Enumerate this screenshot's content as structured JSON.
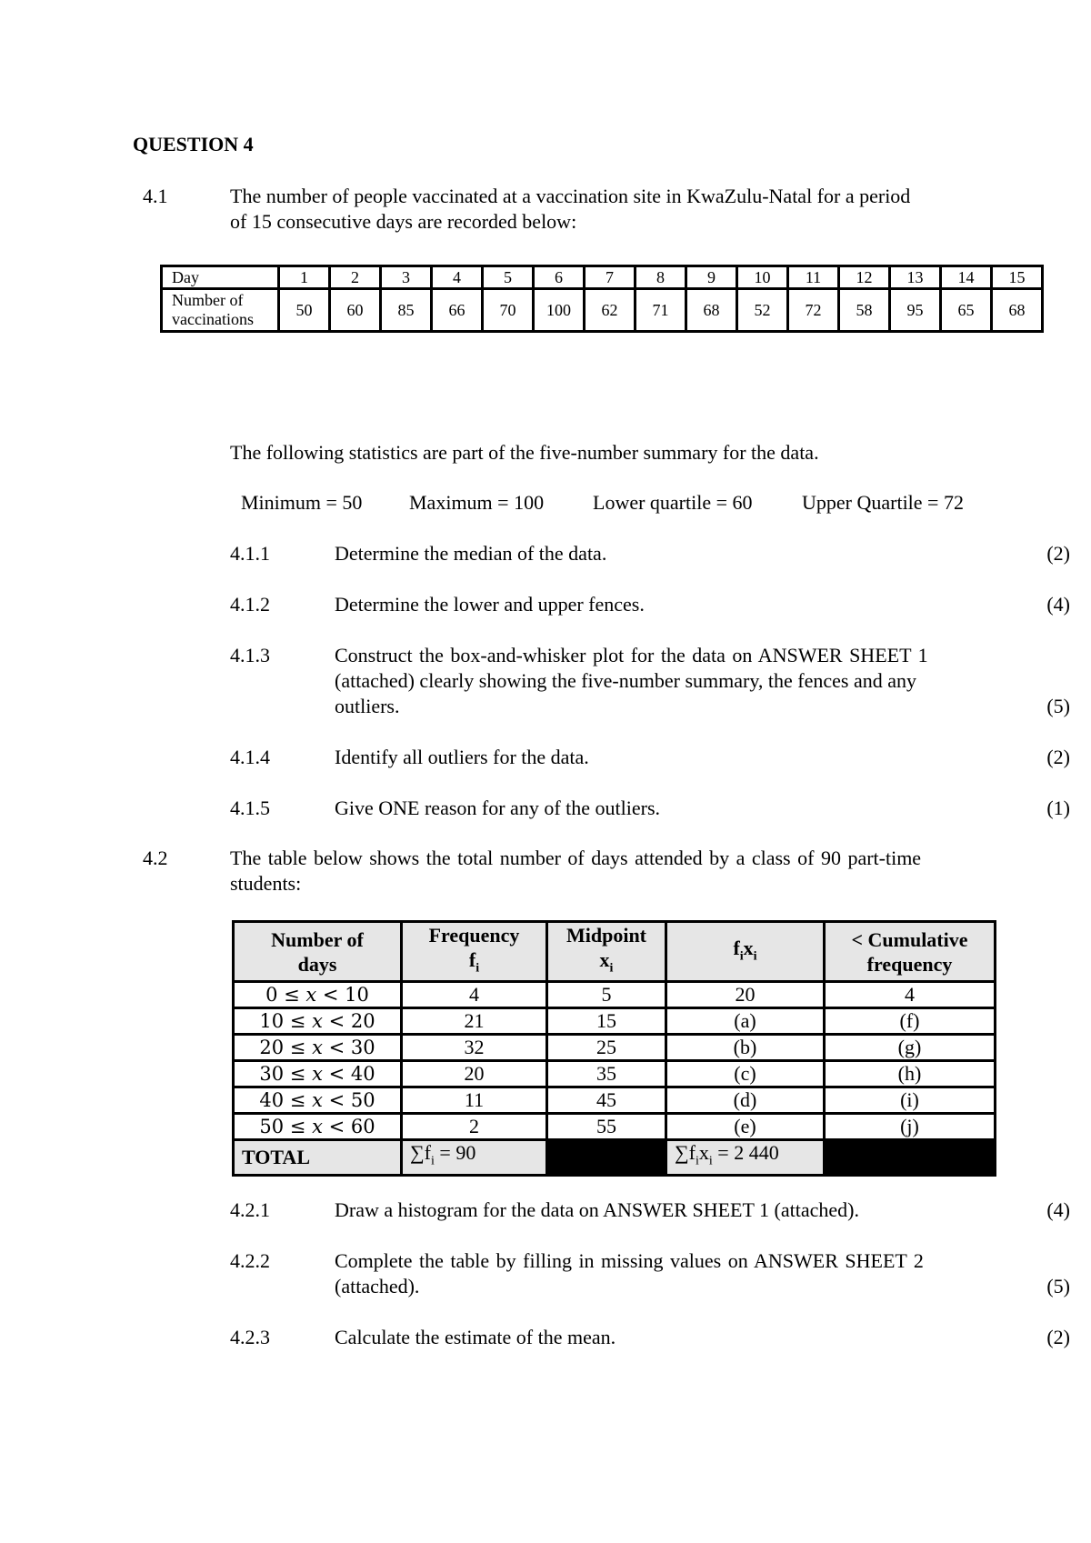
{
  "question_title": "QUESTION 4",
  "q41": {
    "number": "4.1",
    "intro_line1": "The number of people vaccinated at a vaccination site in KwaZulu-Natal for a period",
    "intro_line2": "of 15 consecutive days are recorded below:",
    "table": {
      "row1_label": "Day",
      "row2_label_line1": "Number of",
      "row2_label_line2": "vaccinations",
      "days": [
        "1",
        "2",
        "3",
        "4",
        "5",
        "6",
        "7",
        "8",
        "9",
        "10",
        "11",
        "12",
        "13",
        "14",
        "15"
      ],
      "vaccinations": [
        "50",
        "60",
        "85",
        "66",
        "70",
        "100",
        "62",
        "71",
        "68",
        "52",
        "72",
        "58",
        "95",
        "65",
        "68"
      ]
    },
    "summary_intro": "The following statistics are part of the five-number summary for the data.",
    "summary": {
      "minimum": "Minimum = 50",
      "maximum": "Maximum = 100",
      "lower_quartile": "Lower quartile = 60",
      "upper_quartile": "Upper Quartile = 72"
    },
    "subquestions": [
      {
        "number": "4.1.1",
        "text": "Determine the median of the data.",
        "marks": "(2)"
      },
      {
        "number": "4.1.2",
        "text": "Determine the lower and upper fences.",
        "marks": "(4)"
      },
      {
        "number": "4.1.3",
        "text_line1": "Construct the box-and-whisker plot for the data on ANSWER SHEET 1",
        "text_line2": "(attached) clearly showing the five-number summary, the fences and any",
        "text_line3": "outliers.",
        "marks": "(5)"
      },
      {
        "number": "4.1.4",
        "text": "Identify all outliers for the data.",
        "marks": "(2)"
      },
      {
        "number": "4.1.5",
        "text": "Give ONE reason for any of the outliers.",
        "marks": "(1)"
      }
    ]
  },
  "q42": {
    "number": "4.2",
    "intro_line1": "The table below shows the total number of days attended by a class of 90 part-time",
    "intro_line2": "students:",
    "table": {
      "headers": {
        "col1_line1": "Number of",
        "col1_line2": "days",
        "col2_line1": "Frequency",
        "col2_sym": "f",
        "col2_sub": "i",
        "col3_line1": "Midpoint",
        "col3_sym": "x",
        "col3_sub": "i",
        "col4_f": "f",
        "col4_fsub": "i",
        "col4_x": "x",
        "col4_xsub": "i",
        "col5_line1": "< Cumulative",
        "col5_line2": "frequency"
      },
      "rows": [
        {
          "interval": "0 ≤ 𝑥 < 10",
          "frequency": "4",
          "midpoint": "5",
          "fx": "20",
          "cumulative": "4"
        },
        {
          "interval": "10 ≤ 𝑥 < 20",
          "frequency": "21",
          "midpoint": "15",
          "fx": "(a)",
          "cumulative": "(f)"
        },
        {
          "interval": "20 ≤ 𝑥 < 30",
          "frequency": "32",
          "midpoint": "25",
          "fx": "(b)",
          "cumulative": "(g)"
        },
        {
          "interval": "30 ≤ 𝑥 < 40",
          "frequency": "20",
          "midpoint": "35",
          "fx": "(c)",
          "cumulative": "(h)"
        },
        {
          "interval": "40 ≤ 𝑥 < 50",
          "frequency": "11",
          "midpoint": "45",
          "fx": "(d)",
          "cumulative": "(i)"
        },
        {
          "interval": "50 ≤ 𝑥 < 60",
          "frequency": "2",
          "midpoint": "55",
          "fx": "(e)",
          "cumulative": "(j)"
        }
      ],
      "total": {
        "label": "TOTAL",
        "sum_f_prefix": "∑f",
        "sum_f_sub": "i",
        "sum_f_value": " = 90",
        "sum_fx_prefix": "∑f",
        "sum_fx_sub1": "i",
        "sum_fx_x": "x",
        "sum_fx_sub2": "i",
        "sum_fx_value": " = 2 440"
      }
    },
    "subquestions": [
      {
        "number": "4.2.1",
        "text": "Draw a histogram for the data on ANSWER SHEET 1 (attached).",
        "marks": "(4)"
      },
      {
        "number": "4.2.2",
        "text_line1": "Complete the table by filling in missing values on ANSWER SHEET 2",
        "text_line2": "(attached).",
        "marks": "(5)"
      },
      {
        "number": "4.2.3",
        "text": "Calculate the estimate of the mean.",
        "marks": "(2)"
      }
    ]
  }
}
